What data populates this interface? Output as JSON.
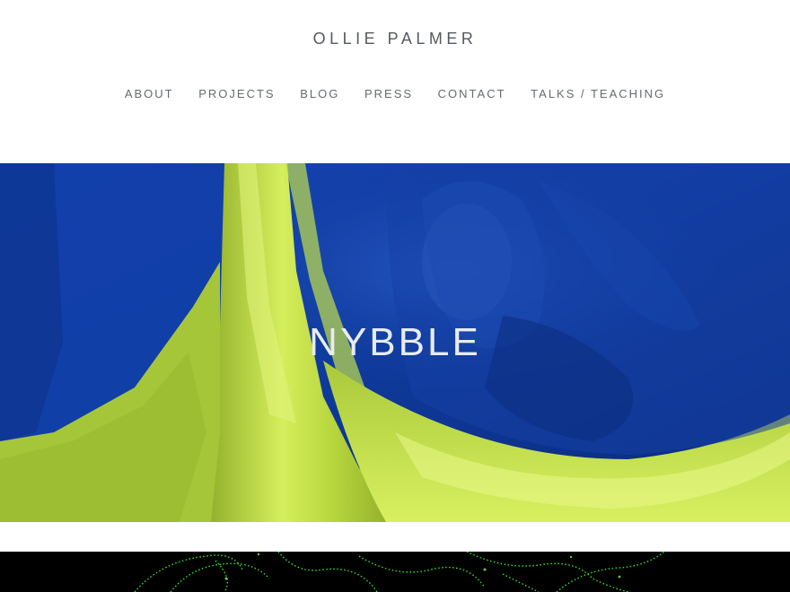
{
  "site": {
    "title": "OLLIE PALMER"
  },
  "nav": {
    "items": [
      {
        "label": "ABOUT"
      },
      {
        "label": "PROJECTS"
      },
      {
        "label": "BLOG"
      },
      {
        "label": "PRESS"
      },
      {
        "label": "CONTACT"
      },
      {
        "label": "TALKS / TEACHING"
      }
    ]
  },
  "hero": {
    "title": "NYBBLE",
    "colors": {
      "fabric_blue": "#0f3a9c",
      "fabric_green": "#c8e24a",
      "shadow": "#062060"
    }
  },
  "next_project": {
    "colors": {
      "background": "#000000",
      "glow": "#3cff3c"
    }
  }
}
